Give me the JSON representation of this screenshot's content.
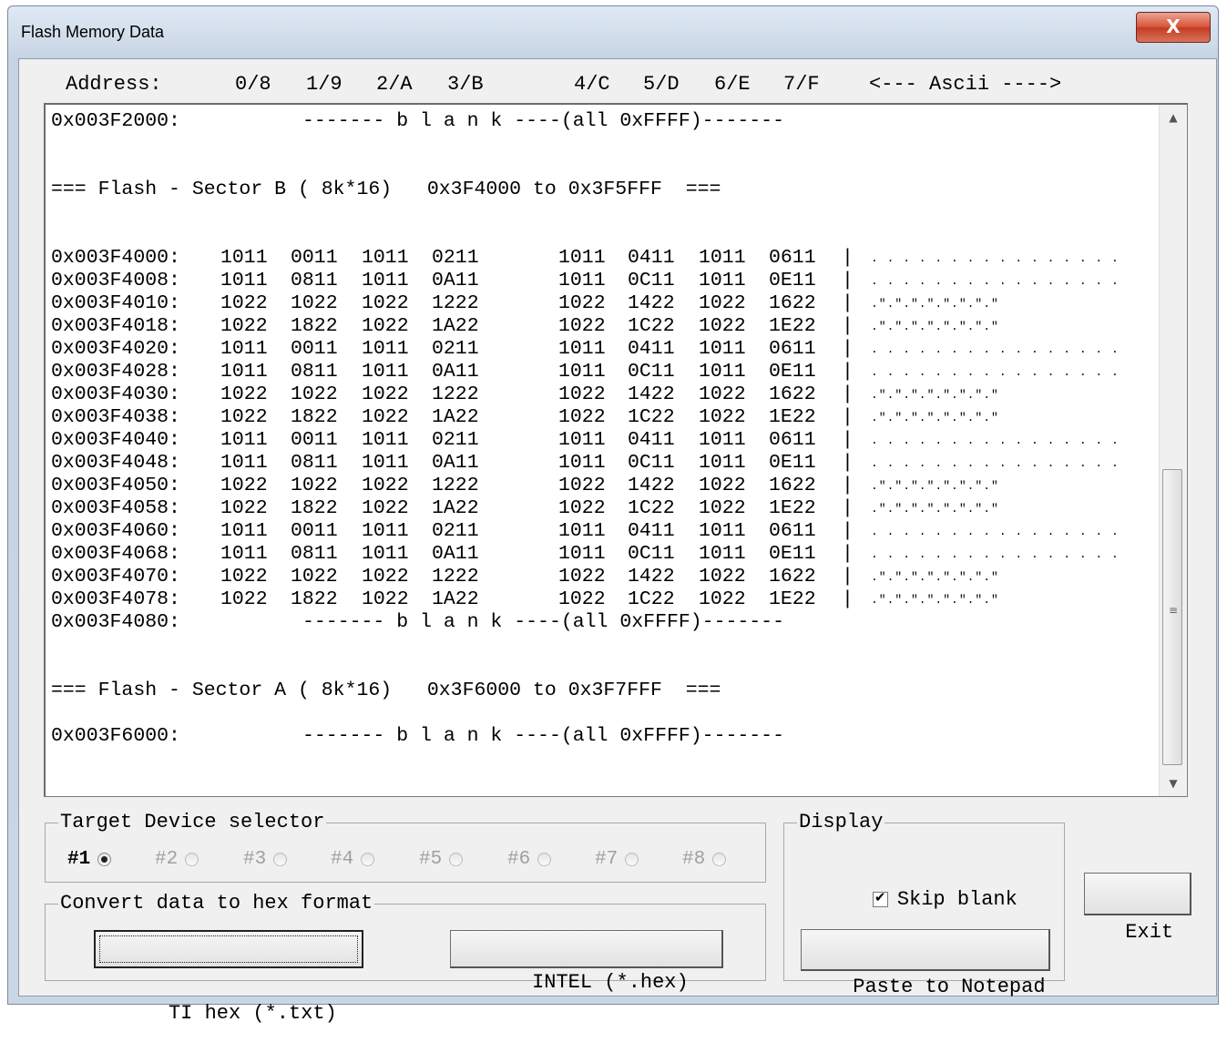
{
  "window": {
    "title": "Flash Memory Data",
    "close_label": "X"
  },
  "header": {
    "address": "Address:",
    "col0": "0/8",
    "col1": "1/9",
    "col2": "2/A",
    "col3": "3/B",
    "col4": "4/C",
    "col5": "5/D",
    "col6": "6/E",
    "col7": "7/F",
    "ascii": "<--- Ascii ---->"
  },
  "memory": {
    "blank_text": "------- b l a n k ----(all 0xFFFF)-------",
    "sector_b": "=== Flash - Sector B ( 8k*16)   0x3F4000 to 0x3F5FFF  ===",
    "sector_a": "=== Flash - Sector A ( 8k*16)   0x3F6000 to 0x3F7FFF  ===",
    "blank_addr_1": "0x003F2000:",
    "blank_addr_2": "0x003F4080:",
    "blank_addr_3": "0x003F6000:",
    "separator": "|",
    "rows": [
      {
        "addr": "0x003F4000:",
        "w": [
          "1011",
          "0011",
          "1011",
          "0211",
          "1011",
          "0411",
          "1011",
          "0611"
        ],
        "ascii": ". . . . . . . . . . . . . . . ."
      },
      {
        "addr": "0x003F4008:",
        "w": [
          "1011",
          "0811",
          "1011",
          "0A11",
          "1011",
          "0C11",
          "1011",
          "0E11"
        ],
        "ascii": ". . . . . . . . . . . . . . . ."
      },
      {
        "addr": "0x003F4010:",
        "w": [
          "1022",
          "1022",
          "1022",
          "1222",
          "1022",
          "1422",
          "1022",
          "1622"
        ],
        "ascii": ".\".\".\".\".\".\".\".\""
      },
      {
        "addr": "0x003F4018:",
        "w": [
          "1022",
          "1822",
          "1022",
          "1A22",
          "1022",
          "1C22",
          "1022",
          "1E22"
        ],
        "ascii": ".\".\".\".\".\".\".\".\""
      },
      {
        "addr": "0x003F4020:",
        "w": [
          "1011",
          "0011",
          "1011",
          "0211",
          "1011",
          "0411",
          "1011",
          "0611"
        ],
        "ascii": ". . . . . . . . . . . . . . . ."
      },
      {
        "addr": "0x003F4028:",
        "w": [
          "1011",
          "0811",
          "1011",
          "0A11",
          "1011",
          "0C11",
          "1011",
          "0E11"
        ],
        "ascii": ". . . . . . . . . . . . . . . ."
      },
      {
        "addr": "0x003F4030:",
        "w": [
          "1022",
          "1022",
          "1022",
          "1222",
          "1022",
          "1422",
          "1022",
          "1622"
        ],
        "ascii": ".\".\".\".\".\".\".\".\""
      },
      {
        "addr": "0x003F4038:",
        "w": [
          "1022",
          "1822",
          "1022",
          "1A22",
          "1022",
          "1C22",
          "1022",
          "1E22"
        ],
        "ascii": ".\".\".\".\".\".\".\".\""
      },
      {
        "addr": "0x003F4040:",
        "w": [
          "1011",
          "0011",
          "1011",
          "0211",
          "1011",
          "0411",
          "1011",
          "0611"
        ],
        "ascii": ". . . . . . . . . . . . . . . ."
      },
      {
        "addr": "0x003F4048:",
        "w": [
          "1011",
          "0811",
          "1011",
          "0A11",
          "1011",
          "0C11",
          "1011",
          "0E11"
        ],
        "ascii": ". . . . . . . . . . . . . . . ."
      },
      {
        "addr": "0x003F4050:",
        "w": [
          "1022",
          "1022",
          "1022",
          "1222",
          "1022",
          "1422",
          "1022",
          "1622"
        ],
        "ascii": ".\".\".\".\".\".\".\".\""
      },
      {
        "addr": "0x003F4058:",
        "w": [
          "1022",
          "1822",
          "1022",
          "1A22",
          "1022",
          "1C22",
          "1022",
          "1E22"
        ],
        "ascii": ".\".\".\".\".\".\".\".\""
      },
      {
        "addr": "0x003F4060:",
        "w": [
          "1011",
          "0011",
          "1011",
          "0211",
          "1011",
          "0411",
          "1011",
          "0611"
        ],
        "ascii": ". . . . . . . . . . . . . . . ."
      },
      {
        "addr": "0x003F4068:",
        "w": [
          "1011",
          "0811",
          "1011",
          "0A11",
          "1011",
          "0C11",
          "1011",
          "0E11"
        ],
        "ascii": ". . . . . . . . . . . . . . . ."
      },
      {
        "addr": "0x003F4070:",
        "w": [
          "1022",
          "1022",
          "1022",
          "1222",
          "1022",
          "1422",
          "1022",
          "1622"
        ],
        "ascii": ".\".\".\".\".\".\".\".\""
      },
      {
        "addr": "0x003F4078:",
        "w": [
          "1022",
          "1822",
          "1022",
          "1A22",
          "1022",
          "1C22",
          "1022",
          "1E22"
        ],
        "ascii": ".\".\".\".\".\".\".\".\""
      }
    ]
  },
  "target_device": {
    "legend": "Target Device selector",
    "options": [
      {
        "label": "#1",
        "checked": true,
        "enabled": true
      },
      {
        "label": "#2",
        "checked": false,
        "enabled": false
      },
      {
        "label": "#3",
        "checked": false,
        "enabled": false
      },
      {
        "label": "#4",
        "checked": false,
        "enabled": false
      },
      {
        "label": "#5",
        "checked": false,
        "enabled": false
      },
      {
        "label": "#6",
        "checked": false,
        "enabled": false
      },
      {
        "label": "#7",
        "checked": false,
        "enabled": false
      },
      {
        "label": "#8",
        "checked": false,
        "enabled": false
      }
    ]
  },
  "convert": {
    "legend": "Convert data to hex format",
    "ti_hex": "TI hex (*.txt)",
    "intel_hex": "INTEL (*.hex)"
  },
  "display": {
    "legend": "Display",
    "skip_blank": "Skip blank",
    "skip_blank_checked": true,
    "paste": "Paste to Notepad"
  },
  "exit_label": "Exit"
}
